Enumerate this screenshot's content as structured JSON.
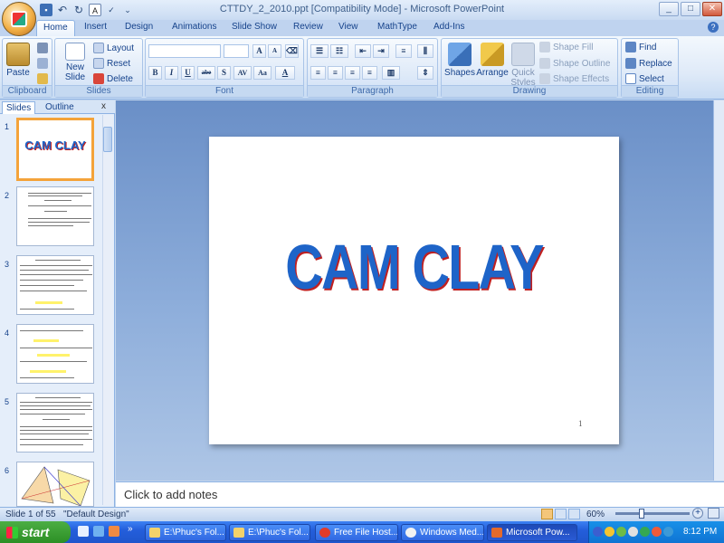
{
  "window": {
    "title": "CTTDY_2_2010.ppt [Compatibility Mode] - Microsoft PowerPoint",
    "buttons": [
      "_",
      "□",
      "✕"
    ]
  },
  "quick_access": {
    "undo": "↶",
    "redo": "↻"
  },
  "tabs": [
    "Home",
    "Insert",
    "Design",
    "Animations",
    "Slide Show",
    "Review",
    "View",
    "MathType",
    "Add-Ins"
  ],
  "active_tab": "Home",
  "help": "?",
  "ribbon": {
    "clipboard": {
      "label": "Clipboard",
      "paste": "Paste"
    },
    "slides": {
      "label": "Slides",
      "new_slide_1": "New",
      "new_slide_2": "Slide",
      "layout": "Layout",
      "reset": "Reset",
      "delete": "Delete"
    },
    "font": {
      "label": "Font",
      "buttons": [
        "B",
        "I",
        "U",
        "abe",
        "S",
        "AV",
        "Aa",
        "A"
      ],
      "grow": "A",
      "shrink": "A"
    },
    "paragraph": {
      "label": "Paragraph"
    },
    "drawing": {
      "label": "Drawing",
      "shapes": "Shapes",
      "arrange": "Arrange",
      "quick_styles_1": "Quick",
      "quick_styles_2": "Styles",
      "shape_fill": "Shape Fill",
      "shape_outline": "Shape Outline",
      "shape_effects": "Shape Effects"
    },
    "editing": {
      "label": "Editing",
      "find": "Find",
      "replace": "Replace",
      "select": "Select"
    }
  },
  "pane": {
    "tabs": [
      "Slides",
      "Outline"
    ],
    "close": "x",
    "slide_numbers": [
      "1",
      "2",
      "3",
      "4",
      "5",
      "6"
    ],
    "thumb1_title": "CAM CLAY"
  },
  "slide": {
    "title": "CAM CLAY",
    "number": "1"
  },
  "notes": {
    "placeholder": "Click to add notes"
  },
  "status": {
    "slide_info": "Slide 1 of 55",
    "theme": "\"Default Design\"",
    "zoom": "60%",
    "zoom_level_pct": 60
  },
  "taskbar": {
    "start": "start",
    "tasks": [
      "E:\\Phuc's Fol...",
      "E:\\Phuc's Fol...",
      "Free File Host...",
      "Windows Med...",
      "Microsoft Pow..."
    ],
    "clock": "8:12 PM"
  },
  "colors": {
    "title_text": "#1e64c8",
    "title_shadow": "#c02020",
    "selected_thumb": "#f4a33a",
    "taskbar": "#245edb",
    "start": "#3c9a35"
  }
}
